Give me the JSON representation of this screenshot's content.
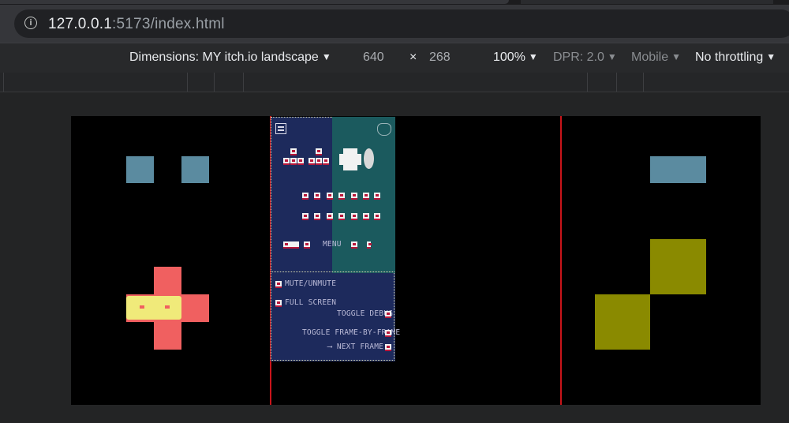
{
  "browser": {
    "url_host": "127.0.0.1",
    "url_rest": ":5173/index.html",
    "info_icon": "info-icon"
  },
  "device_toolbar": {
    "dimensions_label": "Dimensions: MY itch.io landscape",
    "width": "640",
    "times": "×",
    "height": "268",
    "zoom": "100%",
    "dpr": "DPR: 2.0",
    "mobile": "Mobile",
    "throttling": "No throttling",
    "caret": "▼"
  },
  "game": {
    "colors": {
      "background": "#000000",
      "guide_line": "#c9141a",
      "teal_block": "#5b8ba0",
      "olive_block": "#8a8a00",
      "dpad": "#f06060",
      "dpad_highlight": "#f0ea7a",
      "panel_navy": "#1d2a5c",
      "panel_teal": "#1b5a5e",
      "key_accent": "#b8173a"
    },
    "help_panel": {
      "labels": {
        "menu": "MENU",
        "mute": "MUTE/UNMUTE",
        "fullscreen": "FULL SCREEN",
        "toggle_debug": "TOGGLE DEBUG",
        "toggle_frame": "TOGGLE FRAME-BY-FRAME",
        "next_frame": "⟶ NEXT FRAME"
      }
    }
  }
}
